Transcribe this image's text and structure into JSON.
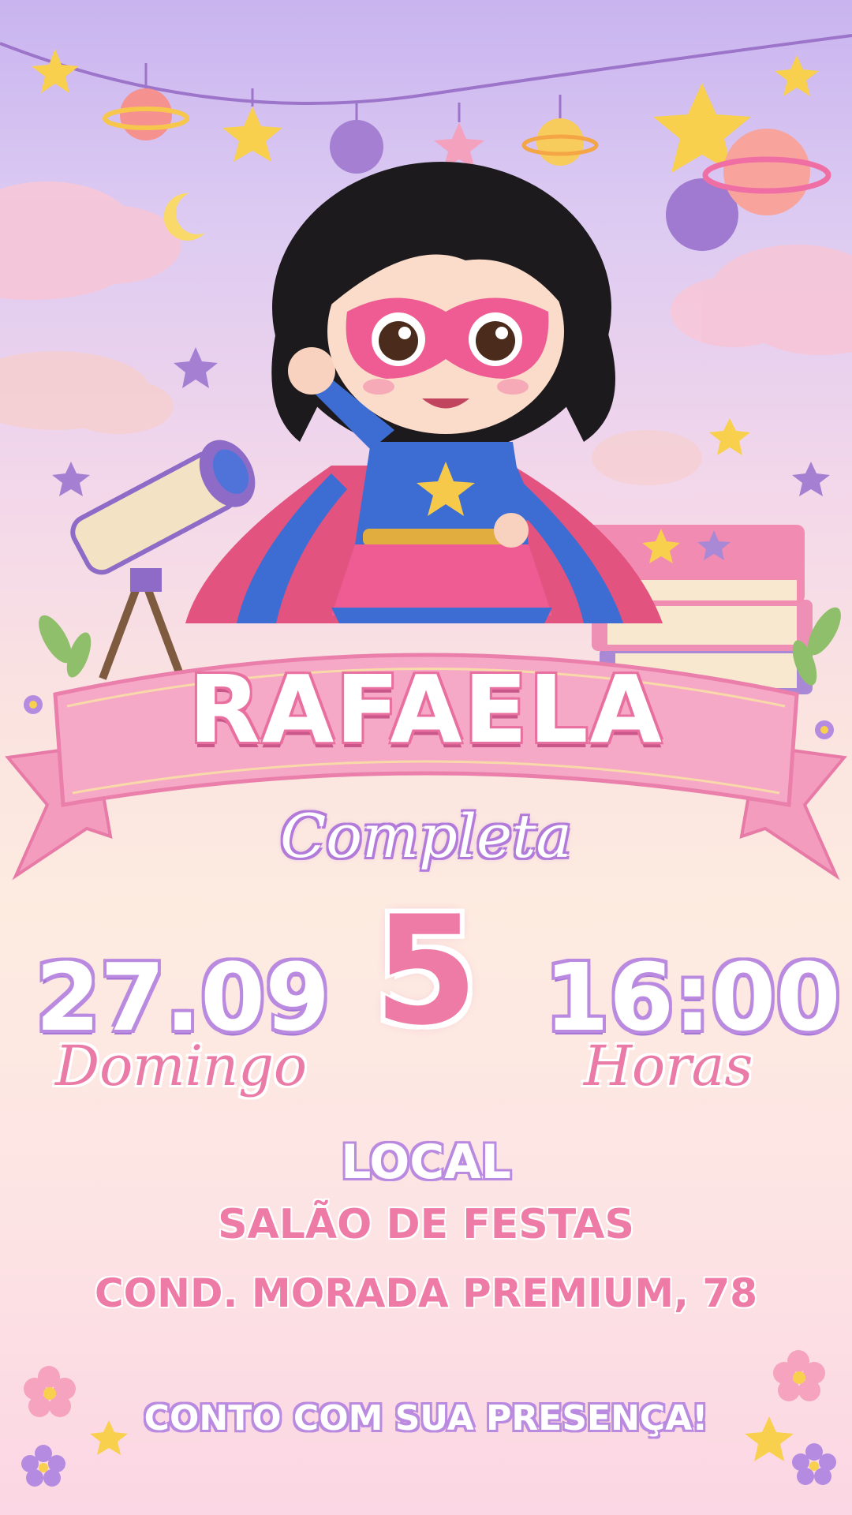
{
  "invite": {
    "name": "RAFAELA",
    "completa": "Completa",
    "age": "5",
    "date": "27.09",
    "weekday": "Domingo",
    "time": "16:00",
    "time_label": "Horas",
    "local_heading": "LOCAL",
    "venue": "SALÃO DE FESTAS",
    "address": "COND. MORADA PREMIUM, 78",
    "rsvp": "CONTO COM SUA PRESENÇA!"
  },
  "colors": {
    "accent_pink": "#ee7aa6",
    "accent_purple": "#b98ae0",
    "banner_pink": "#f6a9c6"
  },
  "decorations": [
    "bunting-garland",
    "planet-icon",
    "star-icon",
    "moon-icon",
    "cloud",
    "telescope",
    "book-stack",
    "superhero-girl",
    "flower-icon",
    "ribbon-banner"
  ]
}
